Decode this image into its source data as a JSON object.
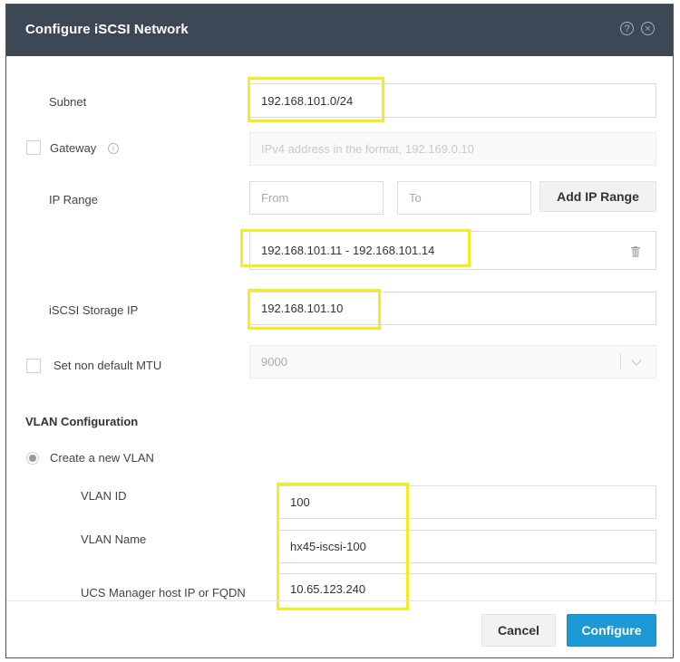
{
  "dialog": {
    "title": "Configure iSCSI Network",
    "help_icon": "?",
    "close_icon": "×"
  },
  "form": {
    "subnet": {
      "label": "Subnet",
      "value": "192.168.101.0/24"
    },
    "gateway": {
      "label": "Gateway",
      "checked": false,
      "info_icon": "i",
      "placeholder": "IPv4 address in the format, 192.169.0.10"
    },
    "ip_range": {
      "label": "IP Range",
      "from_placeholder": "From",
      "to_placeholder": "To",
      "add_button": "Add IP Range",
      "ranges": [
        "192.168.101.11 - 192.168.101.14"
      ]
    },
    "iscsi_storage_ip": {
      "label": "iSCSI Storage IP",
      "value": "192.168.101.10"
    },
    "mtu": {
      "label": "Set non default MTU",
      "checked": false,
      "value": "9000"
    }
  },
  "vlan": {
    "section_title": "VLAN Configuration",
    "create_new_option": "Create a new VLAN",
    "vlan_id": {
      "label": "VLAN ID",
      "value": "100"
    },
    "vlan_name": {
      "label": "VLAN Name",
      "value": "hx45-iscsi-100"
    },
    "ucs_manager": {
      "label": "UCS Manager host IP or FQDN",
      "value": "10.65.123.240"
    }
  },
  "footer": {
    "cancel": "Cancel",
    "configure": "Configure"
  },
  "colors": {
    "header_bg": "#3c4856",
    "primary": "#1b9ad6",
    "highlight": "#f5ec1f"
  }
}
